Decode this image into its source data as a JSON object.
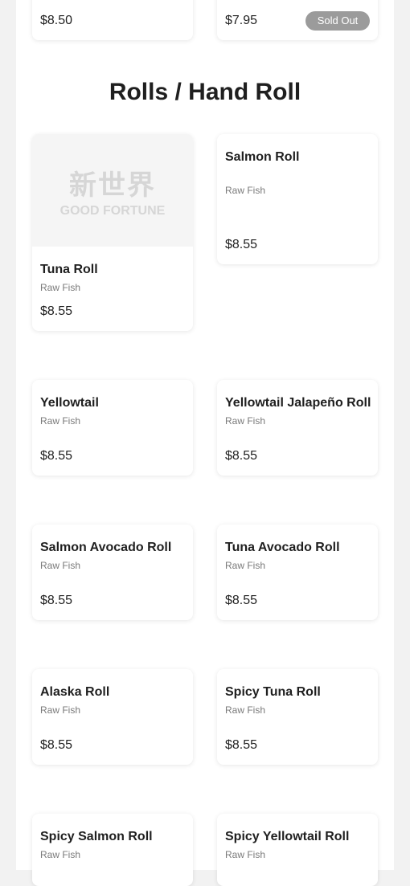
{
  "top_row": [
    {
      "price": "$8.50"
    },
    {
      "price": "$7.95",
      "badge": "Sold Out"
    }
  ],
  "section": {
    "title": "Rolls / Hand Roll"
  },
  "logo": {
    "cn": "新世界",
    "en": "GOOD FORTUNE"
  },
  "items": [
    {
      "name": "Tuna Roll",
      "desc": "Raw Fish",
      "price": "$8.55"
    },
    {
      "name": "Salmon Roll",
      "desc": "Raw Fish",
      "price": "$8.55"
    },
    {
      "name": "Yellowtail",
      "desc": "Raw Fish",
      "price": "$8.55"
    },
    {
      "name": "Yellowtail Jalapeño Roll",
      "desc": "Raw Fish",
      "price": "$8.55"
    },
    {
      "name": "Salmon Avocado Roll",
      "desc": "Raw Fish",
      "price": "$8.55"
    },
    {
      "name": "Tuna Avocado Roll",
      "desc": "Raw Fish",
      "price": "$8.55"
    },
    {
      "name": "Alaska Roll",
      "desc": "Raw Fish",
      "price": "$8.55"
    },
    {
      "name": "Spicy Tuna Roll",
      "desc": "Raw Fish",
      "price": "$8.55"
    },
    {
      "name": "Spicy Salmon Roll",
      "desc": "Raw Fish"
    },
    {
      "name": "Spicy Yellowtail Roll",
      "desc": "Raw Fish"
    }
  ]
}
